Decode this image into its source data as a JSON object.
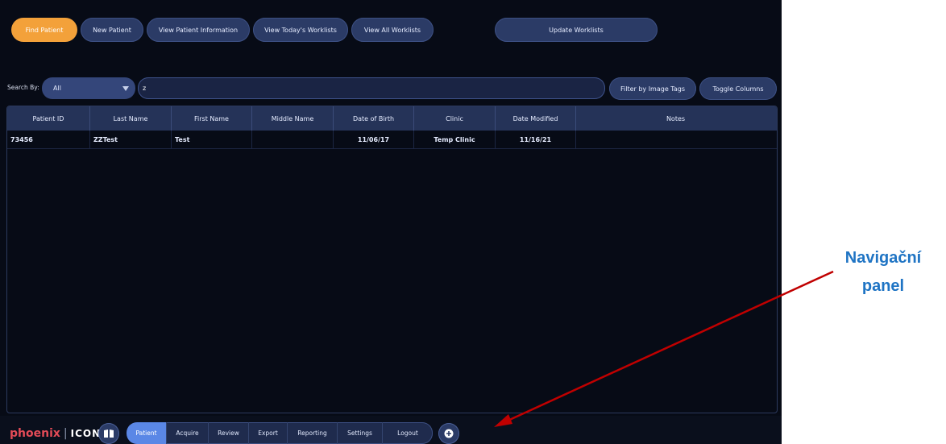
{
  "toolbar": {
    "buttons": [
      {
        "label": "Find Patient",
        "active": true
      },
      {
        "label": "New Patient"
      },
      {
        "label": "View Patient Information"
      },
      {
        "label": "View Today's Worklists"
      },
      {
        "label": "View All Worklists"
      },
      {
        "label": "Update Worklists"
      }
    ]
  },
  "search": {
    "label": "Search By:",
    "field": "All",
    "query": "z",
    "filter_button": "Filter by Image Tags",
    "toggle_button": "Toggle Columns"
  },
  "table": {
    "columns": [
      "Patient ID",
      "Last Name",
      "First Name",
      "Middle Name",
      "Date of Birth",
      "Clinic",
      "Date Modified",
      "Notes"
    ],
    "rows": [
      {
        "patient_id": "73456",
        "last_name": "ZZTest",
        "first_name": "Test",
        "middle_name": "",
        "dob": "11/06/17",
        "clinic": "Temp Clinic",
        "modified": "11/16/21",
        "notes": ""
      }
    ]
  },
  "footer": {
    "logo_phoenix": "phoenix",
    "logo_sep": "|",
    "logo_icon": "ICON",
    "nav": [
      "Patient",
      "Acquire",
      "Review",
      "Export",
      "Reporting",
      "Settings",
      "Logout"
    ],
    "active_nav": "Patient",
    "book_icon": "book-icon",
    "extra_icon": "plus-icon"
  },
  "annotation": {
    "line1": "Navigační",
    "line2": "panel",
    "color": "#1f74c4",
    "arrow_color": "#c00000"
  },
  "colors": {
    "accent": "#f3a13a",
    "button": "#2b3b66",
    "background": "#070b16",
    "nav_active": "#5a87e6"
  }
}
